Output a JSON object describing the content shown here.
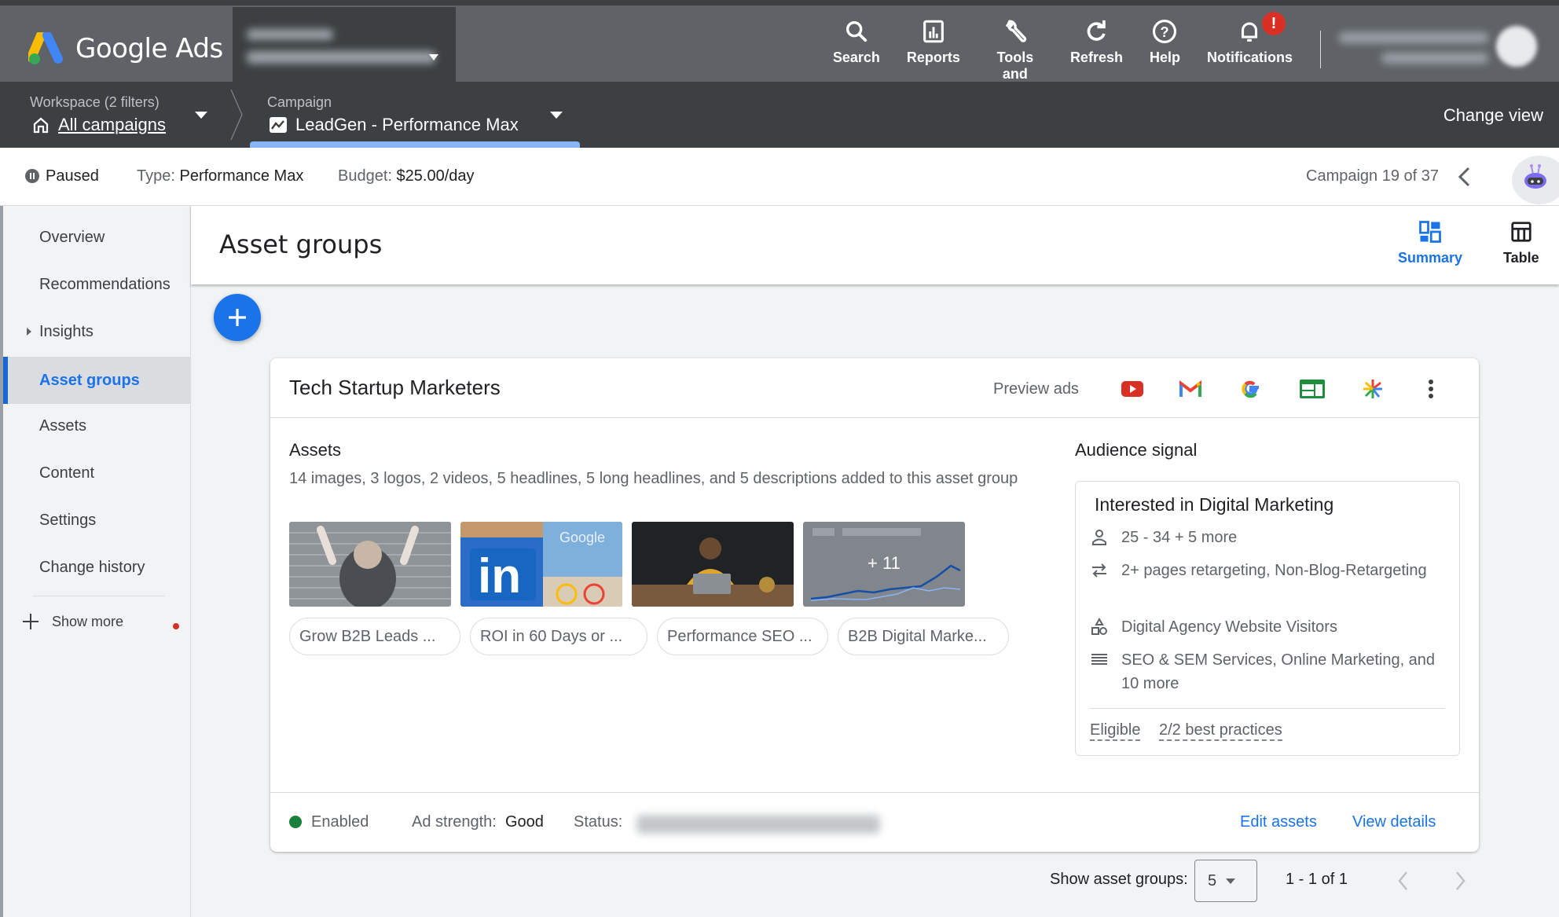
{
  "app": {
    "name": "Google Ads"
  },
  "topbar": {
    "tools": [
      {
        "label": "Search",
        "icon": "search-icon"
      },
      {
        "label": "Reports",
        "icon": "reports-icon"
      },
      {
        "label": "Tools and settings",
        "icon": "wrench-icon"
      },
      {
        "label": "Refresh",
        "icon": "refresh-icon"
      },
      {
        "label": "Help",
        "icon": "help-icon"
      },
      {
        "label": "Notifications",
        "icon": "bell-icon",
        "badge": "!"
      }
    ]
  },
  "breadcrumb": {
    "workspace_label": "Workspace (2 filters)",
    "workspace_value": "All campaigns",
    "campaign_label": "Campaign",
    "campaign_value": "LeadGen - Performance Max",
    "change_view": "Change view"
  },
  "status": {
    "state": "Paused",
    "type_key": "Type:",
    "type_value": "Performance Max",
    "budget_key": "Budget:",
    "budget_value": "$25.00/day",
    "position": "Campaign 19 of 37"
  },
  "sidebar": {
    "items": [
      {
        "label": "Overview"
      },
      {
        "label": "Recommendations"
      },
      {
        "label": "Insights",
        "expandable": true
      },
      {
        "label": "Asset groups",
        "active": true
      },
      {
        "label": "Assets"
      },
      {
        "label": "Content"
      },
      {
        "label": "Settings"
      },
      {
        "label": "Change history"
      }
    ],
    "show_more": "Show more"
  },
  "page": {
    "title": "Asset groups",
    "views": [
      {
        "label": "Summary",
        "active": true
      },
      {
        "label": "Table"
      }
    ]
  },
  "asset_group": {
    "name": "Tech Startup Marketers",
    "preview_label": "Preview ads",
    "preview_channels": [
      "youtube-icon",
      "gmail-icon",
      "google-icon",
      "display-icon",
      "discover-icon"
    ],
    "assets_title": "Assets",
    "assets_summary": "14 images, 3 logos, 2 videos, 5 headlines, 5 long headlines, and 5 descriptions added to this asset group",
    "more_images": "+ 11",
    "headlines": [
      "Grow B2B Leads ...",
      "ROI in 60 Days or ...",
      "Performance SEO ...",
      "B2B Digital Marke..."
    ],
    "audience_title": "Audience signal",
    "audience_name": "Interested in Digital Marketing",
    "audience_rows": [
      {
        "icon": "person-icon",
        "text": "25 - 34 + 5 more"
      },
      {
        "icon": "retarget-icon",
        "text": "2+ pages retargeting, Non-Blog-Retargeting"
      },
      {
        "icon": "segments-icon",
        "text": "Digital Agency Website Visitors"
      },
      {
        "icon": "list-icon",
        "text": "SEO & SEM Services, Online Marketing, and 10 more"
      }
    ],
    "eligible": "Eligible",
    "best_practices": "2/2 best practices",
    "footer": {
      "enabled": "Enabled",
      "ad_strength_key": "Ad strength:",
      "ad_strength_value": "Good",
      "status_key": "Status:",
      "edit_assets": "Edit assets",
      "view_details": "View details"
    }
  },
  "pagination": {
    "show_label": "Show asset groups:",
    "page_size": "5",
    "range": "1 - 1 of 1"
  },
  "colors": {
    "accent": "#1a73e8",
    "enabled": "#188038",
    "alert": "#d93025"
  }
}
